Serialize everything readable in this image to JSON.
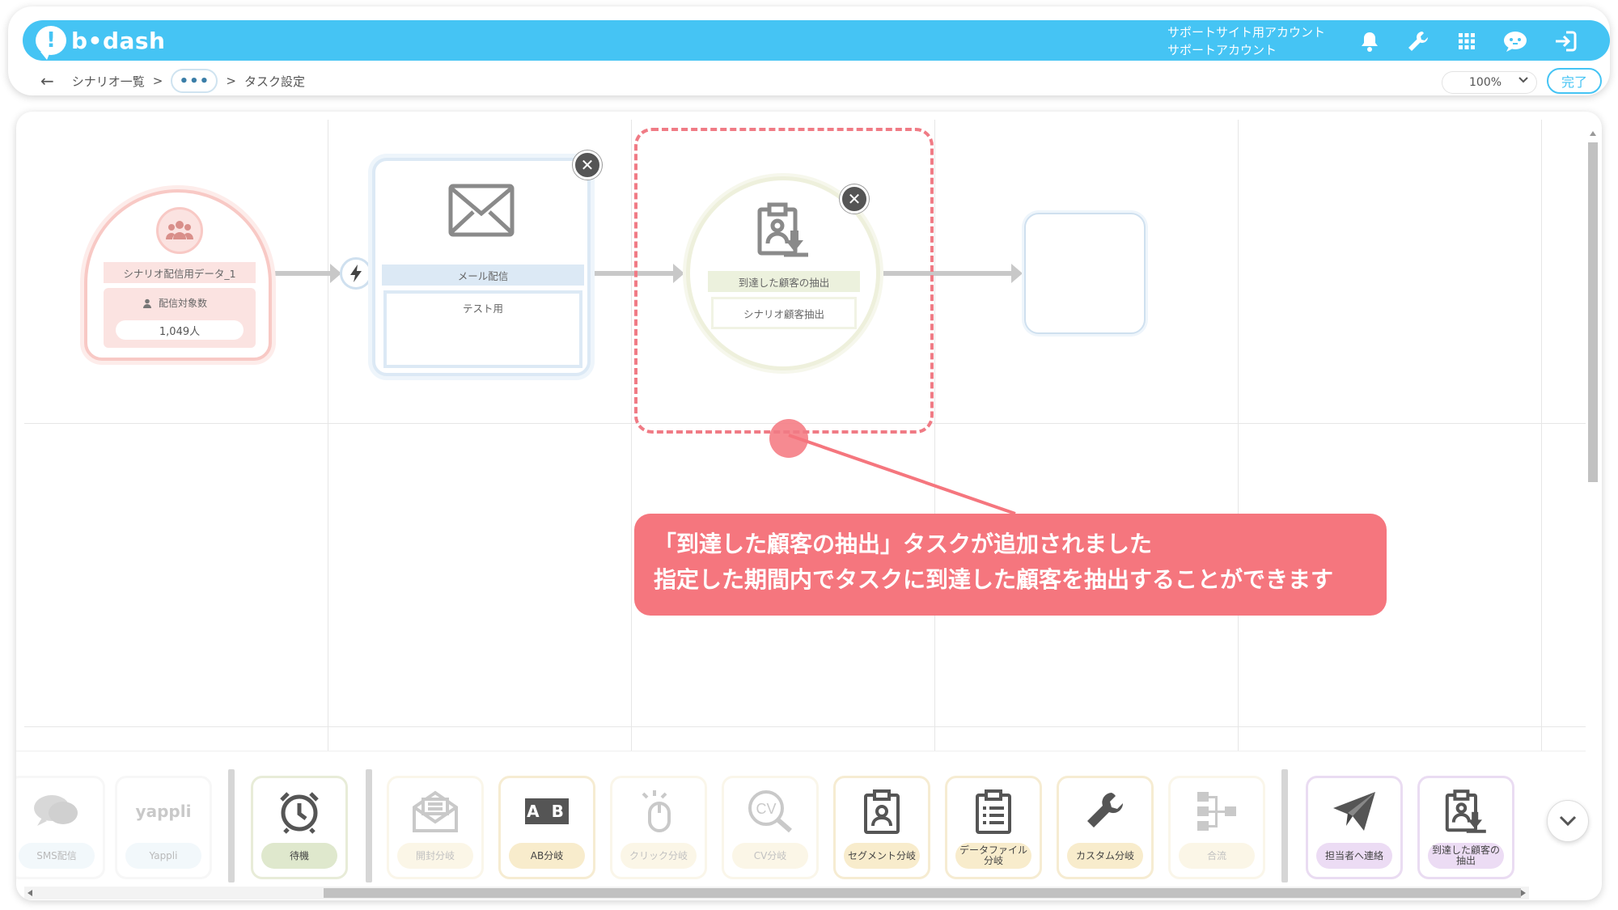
{
  "header": {
    "logo_text": "b•dash",
    "account_line1": "サポートサイト用アカウント",
    "account_line2": "サポートアカウント",
    "icons": [
      "bell-icon",
      "wrench-icon",
      "grid-icon",
      "chat-bot-icon",
      "logout-icon"
    ],
    "accent_color": "#45c4f4"
  },
  "breadcrumb": {
    "back": "←",
    "item1": "シナリオ一覧",
    "sep": ">",
    "ellipsis": "•••",
    "current": "タスク設定"
  },
  "zoom": {
    "value": "100%"
  },
  "done_button": "完了",
  "nodes": {
    "start": {
      "title": "シナリオ配信用データ_1",
      "count_label": "配信対象数",
      "count_value": "1,049人"
    },
    "mail": {
      "title": "メール配信",
      "body": "テスト用"
    },
    "extract": {
      "title": "到達した顧客の抽出",
      "sub": "シナリオ顧客抽出"
    }
  },
  "callout": {
    "line1": "「到達した顧客の抽出」タスクが追加されました",
    "line2": "指定した期間内でタスクに到達した顧客を抽出することができます",
    "color": "#f5767e"
  },
  "palette": [
    {
      "id": "sms",
      "label": "SMS配信",
      "icon": "sms-icon"
    },
    {
      "id": "yappli",
      "label": "Yappli",
      "icon_text": "yappli"
    },
    {
      "id": "wait",
      "label": "待機",
      "icon": "alarm-clock-icon"
    },
    {
      "id": "open",
      "label": "開封分岐",
      "icon": "open-mail-icon"
    },
    {
      "id": "ab",
      "label": "AB分岐",
      "icon_text": "A B"
    },
    {
      "id": "click",
      "label": "クリック分岐",
      "icon": "mouse-click-icon"
    },
    {
      "id": "cv",
      "label": "CV分岐",
      "icon_text": "CV"
    },
    {
      "id": "segment",
      "label": "セグメント分岐",
      "icon": "id-card-icon"
    },
    {
      "id": "datafile",
      "label": "データファイル分岐",
      "icon": "clipboard-list-icon"
    },
    {
      "id": "custom",
      "label": "カスタム分岐",
      "icon": "wrench-icon"
    },
    {
      "id": "merge",
      "label": "合流",
      "icon": "merge-icon"
    },
    {
      "id": "notify",
      "label": "担当者へ連絡",
      "icon": "paper-plane-icon"
    },
    {
      "id": "extract",
      "label": "到達した顧客の抽出",
      "icon": "clipboard-download-icon"
    }
  ]
}
